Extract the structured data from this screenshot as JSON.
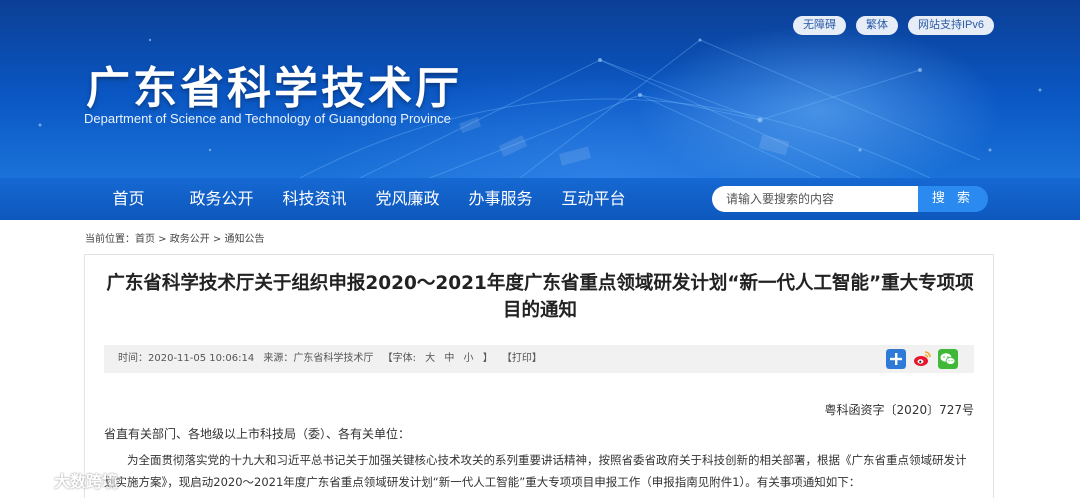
{
  "header": {
    "title": "广东省科学技术厅",
    "subtitle": "Department of Science and Technology of Guangdong Province",
    "util_links": [
      "无障碍",
      "繁体",
      "网站支持IPv6"
    ]
  },
  "nav": {
    "items": [
      "首页",
      "政务公开",
      "科技资讯",
      "党风廉政",
      "办事服务",
      "互动平台"
    ],
    "search_placeholder": "请输入要搜索的内容",
    "search_button": "搜 索"
  },
  "breadcrumb": {
    "prefix": "当前位置：",
    "items": [
      "首页",
      "政务公开",
      "通知公告"
    ],
    "separator": " > "
  },
  "article": {
    "title": "广东省科学技术厅关于组织申报2020～2021年度广东省重点领域研发计划“新一代人工智能”重大专项项目的通知",
    "meta": {
      "time": "时间：2020-11-05 10:06:14",
      "source": "来源：广东省科学技术厅",
      "font_size_label": "【字体:",
      "font_large": "大",
      "font_medium": "中",
      "font_small": "小",
      "font_close": "】",
      "print": "【打印】"
    },
    "doc_number": "粤科函资字〔2020〕727号",
    "salutation": "省直有关部门、各地级以上市科技局（委）、各有关单位：",
    "paragraph": "为全面贯彻落实党的十九大和习近平总书记关于加强关键核心技术攻关的系列重要讲话精神，按照省委省政府关于科技创新的相关部署，根据《广东省重点领域研发计划实施方案》，现启动2020～2021年度广东省重点领域研发计划“新一代人工智能”重大专项项目申报工作（申报指南见附件1）。有关事项通知如下："
  },
  "share": [
    "share-plus-icon",
    "weibo-icon",
    "wechat-icon"
  ],
  "watermark": {
    "text": "大数跨境"
  },
  "colors": {
    "nav_bg": "#1668d2",
    "search_button": "#2b8af0",
    "banner_dark": "#0b3f95",
    "util_text": "#2b5aa6"
  }
}
